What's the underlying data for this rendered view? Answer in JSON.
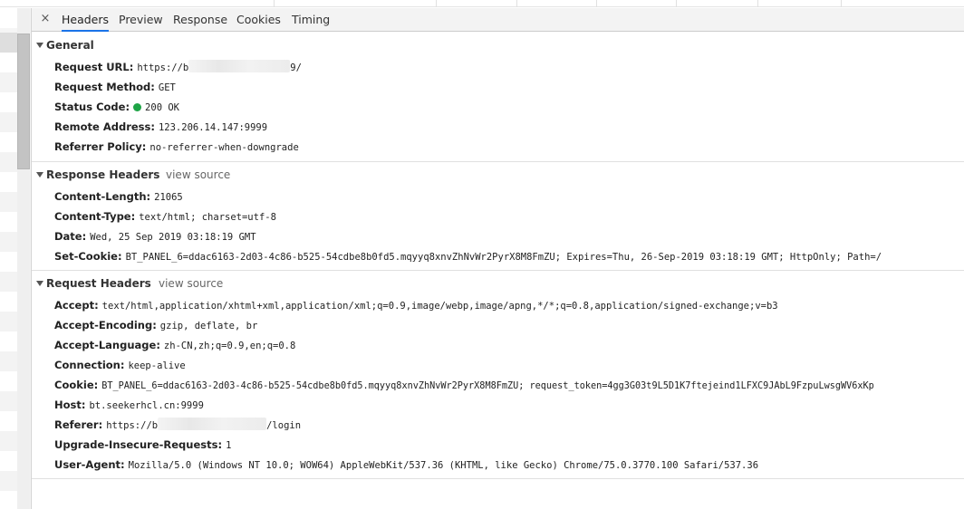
{
  "tabs": {
    "close": "×",
    "items": [
      "Headers",
      "Preview",
      "Response",
      "Cookies",
      "Timing"
    ],
    "active": "Headers",
    "accent": "#1a73e8"
  },
  "general": {
    "title": "General",
    "request_url": {
      "name": "Request URL:",
      "prefix": "https://b",
      "suffix": "9/"
    },
    "request_method": {
      "name": "Request Method:",
      "value": "GET"
    },
    "status_code": {
      "name": "Status Code:",
      "value": "200 OK",
      "dot_color": "#1ea446"
    },
    "remote_address": {
      "name": "Remote Address:",
      "value": "123.206.14.147:9999"
    },
    "referrer_policy": {
      "name": "Referrer Policy:",
      "value": "no-referrer-when-downgrade"
    }
  },
  "response_headers": {
    "title": "Response Headers",
    "view_source": "view source",
    "rows": [
      {
        "name": "Content-Length:",
        "value": "21065"
      },
      {
        "name": "Content-Type:",
        "value": "text/html; charset=utf-8"
      },
      {
        "name": "Date:",
        "value": "Wed, 25 Sep 2019 03:18:19 GMT"
      },
      {
        "name": "Set-Cookie:",
        "value": "BT_PANEL_6=ddac6163-2d03-4c86-b525-54cdbe8b0fd5.mqyyq8xnvZhNvWr2PyrX8M8FmZU; Expires=Thu, 26-Sep-2019 03:18:19 GMT; HttpOnly; Path=/"
      }
    ]
  },
  "request_headers": {
    "title": "Request Headers",
    "view_source": "view source",
    "rows": [
      {
        "name": "Accept:",
        "value": "text/html,application/xhtml+xml,application/xml;q=0.9,image/webp,image/apng,*/*;q=0.8,application/signed-exchange;v=b3"
      },
      {
        "name": "Accept-Encoding:",
        "value": "gzip, deflate, br"
      },
      {
        "name": "Accept-Language:",
        "value": "zh-CN,zh;q=0.9,en;q=0.8"
      },
      {
        "name": "Connection:",
        "value": "keep-alive"
      },
      {
        "name": "Cookie:",
        "value": "BT_PANEL_6=ddac6163-2d03-4c86-b525-54cdbe8b0fd5.mqyyq8xnvZhNvWr2PyrX8M8FmZU; request_token=4gg3G03t9L5D1K7ftejeind1LFXC9JAbL9FzpuLwsgWV6xKp"
      },
      {
        "name": "Host:",
        "value": "bt.seekerhcl.cn:9999"
      }
    ],
    "referer": {
      "name": "Referer:",
      "prefix": "https://b",
      "suffix": "/login"
    },
    "rows2": [
      {
        "name": "Upgrade-Insecure-Requests:",
        "value": "1"
      },
      {
        "name": "User-Agent:",
        "value": "Mozilla/5.0 (Windows NT 10.0; WOW64) AppleWebKit/537.36 (KHTML, like Gecko) Chrome/75.0.3770.100 Safari/537.36"
      }
    ]
  }
}
